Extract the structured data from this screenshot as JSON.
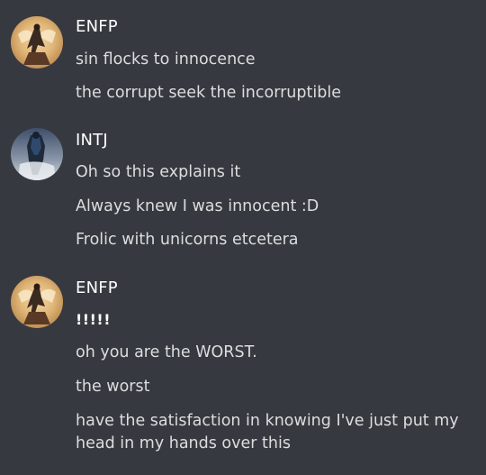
{
  "groups": [
    {
      "author": "ENFP",
      "avatar_icon": "enfp-avatar-icon",
      "messages": [
        "sin flocks to innocence",
        "the corrupt seek the incorruptible"
      ]
    },
    {
      "author": "INTJ",
      "avatar_icon": "intj-avatar-icon",
      "messages": [
        "Oh so this explains it",
        "Always knew I was innocent :D",
        "Frolic with unicorns etcetera"
      ]
    },
    {
      "author": "ENFP",
      "avatar_icon": "enfp-avatar-icon",
      "messages": [
        "!!!!!",
        "oh you are the WORST.",
        "the worst",
        "have the satisfaction in knowing I've just put my head in my hands over this"
      ]
    }
  ],
  "colors": {
    "background": "#36393f",
    "author_text": "#ffffff",
    "message_text": "#dcddde"
  }
}
